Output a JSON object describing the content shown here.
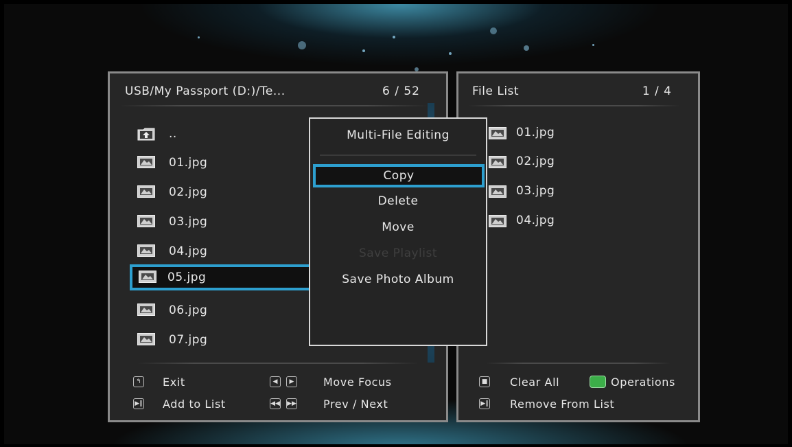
{
  "left_panel": {
    "title": "USB/My Passport (D:)/Te...",
    "count": "6 / 52",
    "items": [
      {
        "label": "..",
        "icon": "folder-up-icon"
      },
      {
        "label": "01.jpg",
        "icon": "image-icon"
      },
      {
        "label": "02.jpg",
        "icon": "image-icon"
      },
      {
        "label": "03.jpg",
        "icon": "image-icon"
      },
      {
        "label": "04.jpg",
        "icon": "image-icon"
      },
      {
        "label": "05.jpg",
        "icon": "image-icon",
        "selected": true
      },
      {
        "label": "06.jpg",
        "icon": "image-icon"
      },
      {
        "label": "07.jpg",
        "icon": "image-icon"
      }
    ],
    "footer": {
      "exit": "Exit",
      "add_to_list": "Add to List",
      "move_focus": "Move Focus",
      "prev_next": "Prev / Next"
    }
  },
  "right_panel": {
    "title": "File List",
    "count": "1 / 4",
    "items": [
      {
        "label": "01.jpg"
      },
      {
        "label": "02.jpg"
      },
      {
        "label": "03.jpg"
      },
      {
        "label": "04.jpg"
      }
    ],
    "footer": {
      "clear_all": "Clear All",
      "operations": "Operations",
      "remove_from_list": "Remove From List"
    }
  },
  "dialog": {
    "title": "Multi-File Editing",
    "items": [
      {
        "label": "Copy",
        "state": "focused"
      },
      {
        "label": "Delete",
        "state": "enabled"
      },
      {
        "label": "Move",
        "state": "enabled"
      },
      {
        "label": "Save Playlist",
        "state": "disabled"
      },
      {
        "label": "Save Photo Album",
        "state": "enabled"
      }
    ]
  },
  "colors": {
    "focus": "#2d9fcf",
    "operations_key": "#3cae49",
    "panel_border": "#8a8a8a"
  }
}
